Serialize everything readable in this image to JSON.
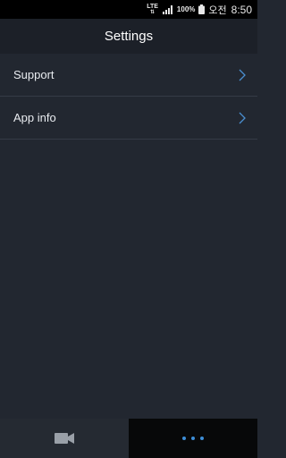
{
  "status_bar": {
    "network": "LTE",
    "battery_percent": "100%",
    "ampm": "오전",
    "time": "8:50"
  },
  "header": {
    "title": "Settings"
  },
  "menu": {
    "items": [
      {
        "label": "Support",
        "icon": "chevron-right-icon"
      },
      {
        "label": "App info",
        "icon": "chevron-right-icon"
      }
    ]
  },
  "bottom_nav": {
    "tabs": [
      {
        "icon": "video-camera-icon",
        "selected": false
      },
      {
        "icon": "more-dots-icon",
        "selected": true
      }
    ]
  },
  "colors": {
    "background": "#222730",
    "header": "#1c2028",
    "chevron": "#4a8fd0",
    "dots": "#3d8ed8"
  }
}
